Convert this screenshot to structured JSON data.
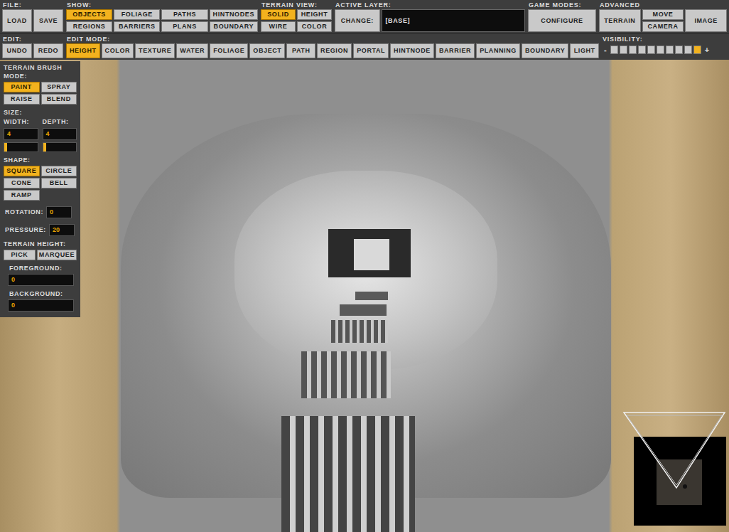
{
  "toolbar": {
    "row1": [
      {
        "label": "FILE:",
        "columns": [
          [
            {
              "label": "LOAD",
              "selected": false
            }
          ],
          [
            {
              "label": "SAVE",
              "selected": false
            }
          ]
        ]
      },
      {
        "label": "SHOW:",
        "columns": [
          [
            {
              "label": "OBJECTS",
              "selected": true
            },
            {
              "label": "REGIONS",
              "selected": false
            }
          ],
          [
            {
              "label": "FOLIAGE",
              "selected": false
            },
            {
              "label": "BARRIERS",
              "selected": false
            }
          ],
          [
            {
              "label": "PATHS",
              "selected": false
            },
            {
              "label": "PLANS",
              "selected": false
            }
          ],
          [
            {
              "label": "HINTNODES",
              "selected": false
            },
            {
              "label": "BOUNDARY",
              "selected": false
            }
          ]
        ]
      },
      {
        "label": "TERRAIN VIEW:",
        "columns": [
          [
            {
              "label": "SOLID",
              "selected": true
            },
            {
              "label": "WIRE",
              "selected": false
            }
          ],
          [
            {
              "label": "HEIGHT",
              "selected": false
            },
            {
              "label": "COLOR",
              "selected": false
            }
          ]
        ]
      },
      {
        "label": "ACTIVE LAYER:",
        "columns": [
          [
            {
              "label": "CHANGE:",
              "selected": false
            }
          ]
        ],
        "field": "[BASE]"
      },
      {
        "label": "GAME MODES:",
        "columns": [
          [
            {
              "label": "CONFIGURE",
              "selected": false
            }
          ]
        ]
      },
      {
        "label": "ADVANCED",
        "columns": [
          [
            {
              "label": "TERRAIN",
              "selected": false
            }
          ],
          [
            {
              "label": "MOVE",
              "selected": false
            },
            {
              "label": "CAMERA",
              "selected": false
            }
          ],
          [
            {
              "label": "IMAGE",
              "selected": false
            }
          ]
        ]
      }
    ],
    "row2": [
      {
        "label": "EDIT:",
        "columns": [
          [
            {
              "label": "UNDO",
              "selected": false
            }
          ],
          [
            {
              "label": "REDO",
              "selected": false
            }
          ]
        ]
      },
      {
        "label": "EDIT MODE:",
        "columns": [
          [
            {
              "label": "HEIGHT",
              "selected": true
            }
          ],
          [
            {
              "label": "COLOR",
              "selected": false
            }
          ],
          [
            {
              "label": "TEXTURE",
              "selected": false
            }
          ],
          [
            {
              "label": "WATER",
              "selected": false
            }
          ],
          [
            {
              "label": "FOLIAGE",
              "selected": false
            }
          ],
          [
            {
              "label": "OBJECT",
              "selected": false
            }
          ],
          [
            {
              "label": "PATH",
              "selected": false
            }
          ],
          [
            {
              "label": "REGION",
              "selected": false
            }
          ],
          [
            {
              "label": "PORTAL",
              "selected": false
            }
          ],
          [
            {
              "label": "HINTNODE",
              "selected": false
            }
          ],
          [
            {
              "label": "BARRIER",
              "selected": false
            }
          ],
          [
            {
              "label": "PLANNING",
              "selected": false
            }
          ],
          [
            {
              "label": "BOUNDARY",
              "selected": false
            }
          ],
          [
            {
              "label": "LIGHT",
              "selected": false
            }
          ]
        ]
      }
    ],
    "visibility": {
      "label": "VISIBILITY:",
      "minus": "-",
      "plus": "+",
      "cells": [
        {
          "selected": false
        },
        {
          "selected": false
        },
        {
          "selected": false
        },
        {
          "selected": false
        },
        {
          "selected": false
        },
        {
          "selected": false
        },
        {
          "selected": false
        },
        {
          "selected": false
        },
        {
          "selected": false
        },
        {
          "selected": true
        }
      ]
    }
  },
  "brush": {
    "title": "TERRAIN BRUSH",
    "mode": {
      "label": "MODE:",
      "buttons": [
        {
          "label": "PAINT",
          "selected": true
        },
        {
          "label": "SPRAY",
          "selected": false
        },
        {
          "label": "RAISE",
          "selected": false
        },
        {
          "label": "BLEND",
          "selected": false
        }
      ]
    },
    "size": {
      "label": "SIZE:",
      "fields": [
        {
          "label": "WIDTH:",
          "value": "4",
          "level": 0.05
        },
        {
          "label": "DEPTH:",
          "value": "4",
          "level": 0.05
        }
      ]
    },
    "shape": {
      "label": "SHAPE:",
      "buttons": [
        {
          "label": "SQUARE",
          "selected": true
        },
        {
          "label": "CIRCLE",
          "selected": false
        },
        {
          "label": "CONE",
          "selected": false
        },
        {
          "label": "BELL",
          "selected": false
        },
        {
          "label": "RAMP",
          "selected": false
        }
      ]
    },
    "rotation": {
      "label": "ROTATION:",
      "value": "0"
    },
    "pressure": {
      "label": "PRESSURE:",
      "value": "20"
    },
    "height": {
      "label": "TERRAIN HEIGHT:",
      "buttons": [
        {
          "label": "PICK",
          "selected": false
        },
        {
          "label": "MARQUEE",
          "selected": false
        }
      ]
    },
    "foreground": {
      "label": "FOREGROUND:",
      "value": "0"
    },
    "background": {
      "label": "BACKGROUND:",
      "value": "0"
    }
  }
}
